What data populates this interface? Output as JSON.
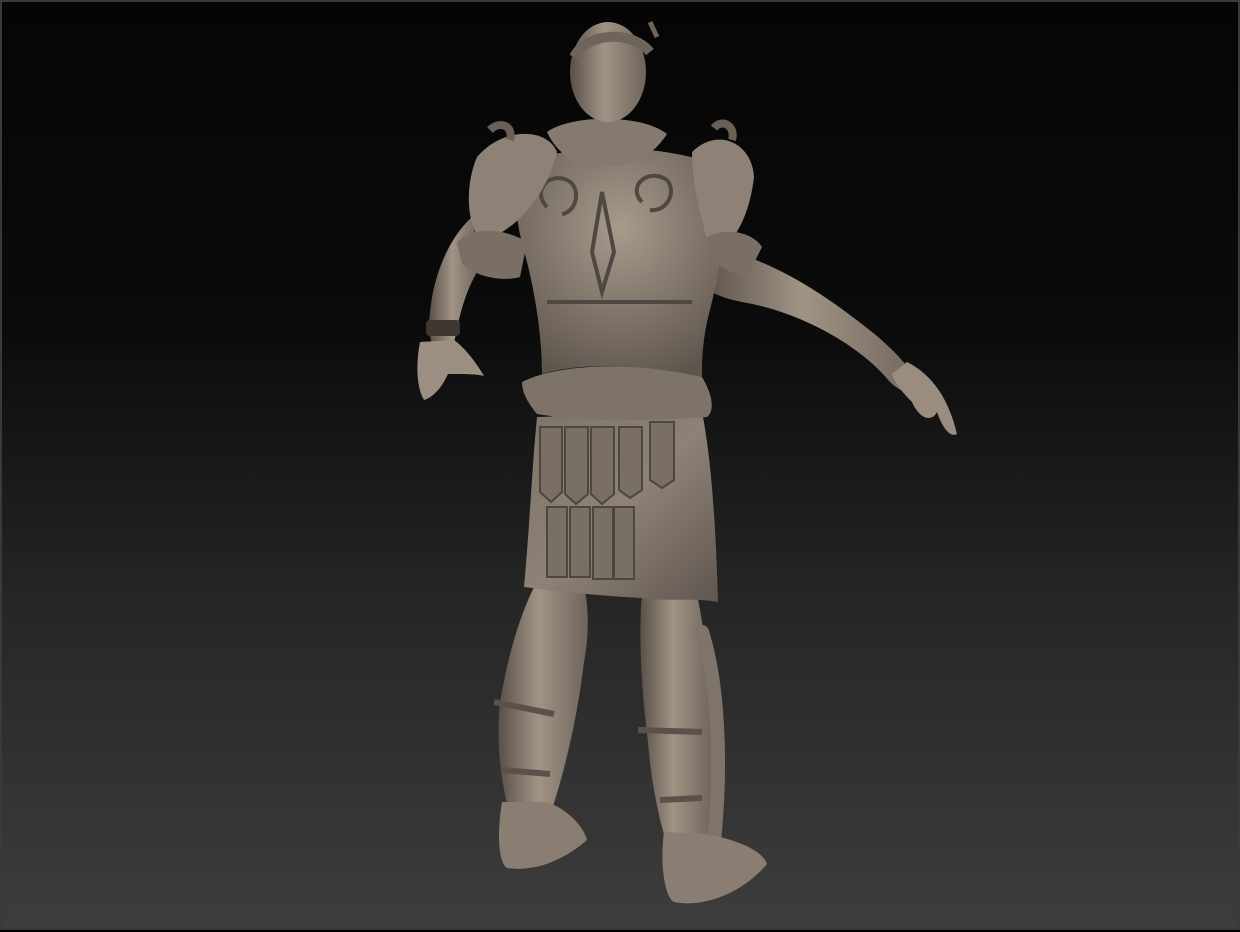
{
  "viewport": {
    "background_top": "#050505",
    "background_bottom": "#3d3d3d",
    "frame_color": "#3a3a3a"
  },
  "model": {
    "subject": "sculpted-figure",
    "material_color": "#8e8276",
    "highlight_color": "#b3a698",
    "shadow_color": "#4d4540"
  }
}
